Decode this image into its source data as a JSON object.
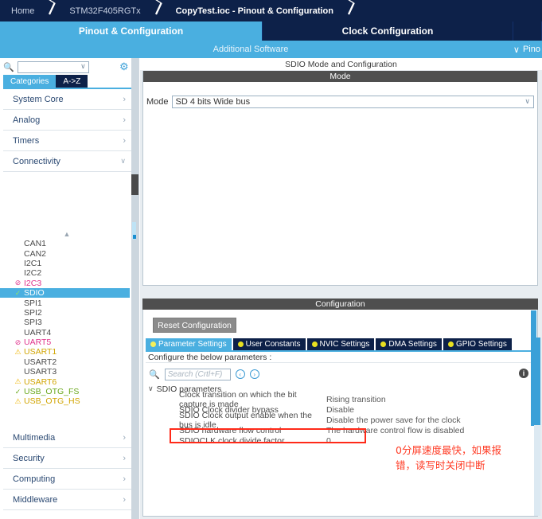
{
  "breadcrumb": {
    "items": [
      {
        "label": "Home",
        "active": false
      },
      {
        "label": "STM32F405RGTx",
        "active": false
      },
      {
        "label": "CopyTest.ioc - Pinout & Configuration",
        "active": true
      }
    ]
  },
  "main_tabs": [
    {
      "label": "Pinout & Configuration",
      "selected": true
    },
    {
      "label": "Clock Configuration",
      "selected": false
    },
    {
      "label": "",
      "selected": false
    }
  ],
  "sub_bar": {
    "center_label": "Additional Software",
    "right_label": "Pino",
    "chevron": "∨"
  },
  "sidebar": {
    "search": {
      "placeholder": "",
      "value": "",
      "icon": "search-icon",
      "chevron": "∨"
    },
    "gear_icon": "gear-icon",
    "view_tabs": [
      {
        "label": "Categories",
        "selected": true
      },
      {
        "label": "A->Z",
        "selected": false
      }
    ],
    "categories_top": [
      {
        "label": "System Core",
        "expanded": false,
        "arrow": "›"
      },
      {
        "label": "Analog",
        "expanded": false,
        "arrow": "›"
      },
      {
        "label": "Timers",
        "expanded": false,
        "arrow": "›"
      },
      {
        "label": "Connectivity",
        "expanded": true,
        "arrow": "∨"
      }
    ],
    "scroll_up_indicator": "▲",
    "peripherals": [
      {
        "label": "CAN1",
        "state": "none",
        "icon": ""
      },
      {
        "label": "CAN2",
        "state": "none",
        "icon": ""
      },
      {
        "label": "I2C1",
        "state": "none",
        "icon": ""
      },
      {
        "label": "I2C2",
        "state": "none",
        "icon": ""
      },
      {
        "label": "I2C3",
        "state": "dis",
        "icon": "⊘"
      },
      {
        "label": "SDIO",
        "state": "selected",
        "icon": "✓"
      },
      {
        "label": "SPI1",
        "state": "none",
        "icon": ""
      },
      {
        "label": "SPI2",
        "state": "none",
        "icon": ""
      },
      {
        "label": "SPI3",
        "state": "none",
        "icon": ""
      },
      {
        "label": "UART4",
        "state": "none",
        "icon": ""
      },
      {
        "label": "UART5",
        "state": "dis",
        "icon": "⊘"
      },
      {
        "label": "USART1",
        "state": "warn",
        "icon": "⚠"
      },
      {
        "label": "USART2",
        "state": "none",
        "icon": ""
      },
      {
        "label": "USART3",
        "state": "none",
        "icon": ""
      },
      {
        "label": "USART6",
        "state": "warn",
        "icon": "⚠"
      },
      {
        "label": "USB_OTG_FS",
        "state": "ok",
        "icon": "✓"
      },
      {
        "label": "USB_OTG_HS",
        "state": "warn",
        "icon": "⚠"
      }
    ],
    "categories_bottom": [
      {
        "label": "Multimedia",
        "arrow": "›"
      },
      {
        "label": "Security",
        "arrow": "›"
      },
      {
        "label": "Computing",
        "arrow": "›"
      },
      {
        "label": "Middleware",
        "arrow": "›"
      }
    ]
  },
  "mode_panel": {
    "title": "SDIO Mode and Configuration",
    "band": "Mode",
    "mode_label": "Mode",
    "mode_value": "SD 4 bits Wide bus",
    "chevron": "∨"
  },
  "config_panel": {
    "band": "Configuration",
    "reset_button": "Reset Configuration",
    "tabs": [
      {
        "label": "Parameter Settings",
        "selected": true
      },
      {
        "label": "User Constants",
        "selected": false
      },
      {
        "label": "NVIC Settings",
        "selected": false
      },
      {
        "label": "DMA Settings",
        "selected": false
      },
      {
        "label": "GPIO Settings",
        "selected": false
      }
    ],
    "hint": "Configure the below parameters :",
    "search_placeholder": "Search (Crtl+F)",
    "search_value": "",
    "nav_prev": "‹",
    "nav_next": "›",
    "info_icon": "i",
    "group": {
      "label": "SDIO parameters",
      "chevron": "∨",
      "rows": [
        {
          "name": "Clock transition on which the bit capture is made",
          "value": "Rising transition",
          "highlighted": false
        },
        {
          "name": "SDIO Clock divider bypass",
          "value": "Disable",
          "highlighted": false
        },
        {
          "name": "SDIO Clock output enable when the bus is idle",
          "value": "Disable the power save for the clock",
          "highlighted": false
        },
        {
          "name": "SDIO hardware flow control",
          "value": "The hardware control flow is disabled",
          "highlighted": false
        },
        {
          "name": "SDIOCLK clock divide factor",
          "value": "0",
          "highlighted": true
        }
      ]
    }
  },
  "annotation": {
    "line1": "0分屏速度最快，如果报",
    "line2": "错，读写时关闭中断",
    "color": "#ff3b24"
  },
  "colors": {
    "header_navy": "#0d2149",
    "accent_blue": "#4aafe0",
    "band_gray": "#4f4f4f",
    "highlight_red": "#ff2a19",
    "warn_yellow": "#f0b400",
    "ok_green": "#6aa81c",
    "disabled_pink": "#e0338c"
  }
}
